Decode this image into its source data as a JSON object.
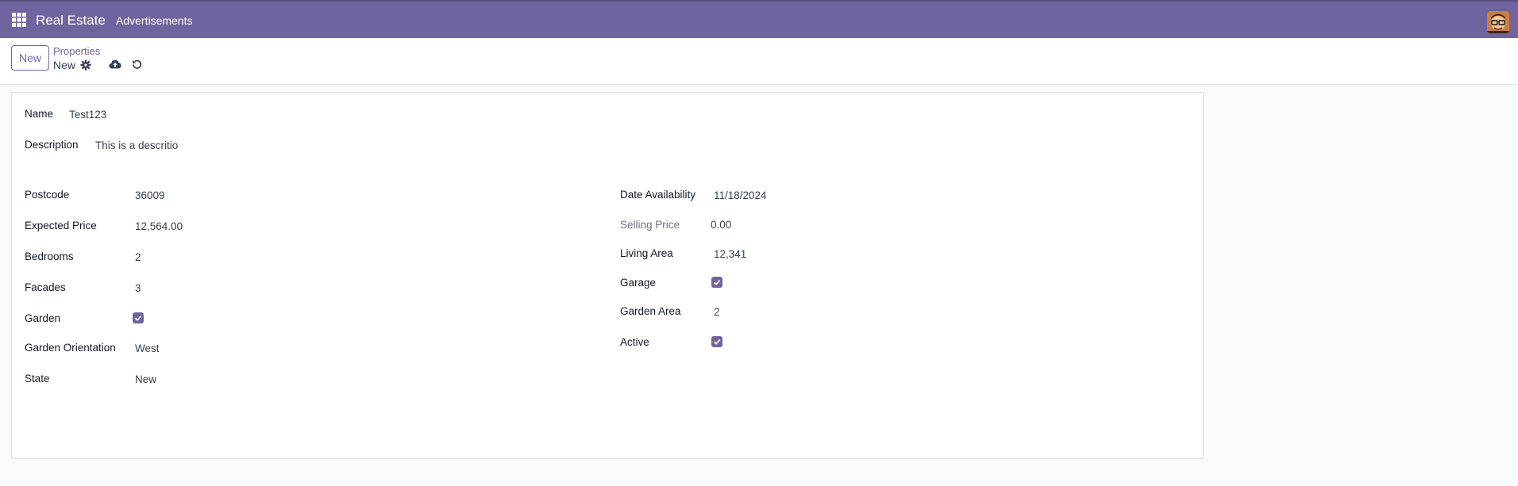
{
  "topbar": {
    "app_name": "Real Estate",
    "menu": [
      "Advertisements"
    ],
    "icons": {
      "apps": "apps-grid-icon",
      "avatar": "user-avatar"
    },
    "colors": {
      "brand": "#71639e"
    }
  },
  "control": {
    "new_label": "New",
    "breadcrumb_parent": "Properties",
    "breadcrumb_current": "New",
    "icons": [
      "gear-icon",
      "cloud-upload-icon",
      "undo-icon"
    ]
  },
  "form": {
    "name_label": "Name",
    "name_value": "Test123",
    "description_label": "Description",
    "description_value": "This is a descritio",
    "left": {
      "postcode_label": "Postcode",
      "postcode_value": "36009",
      "expected_price_label": "Expected Price",
      "expected_price_value": "12,564.00",
      "bedrooms_label": "Bedrooms",
      "bedrooms_value": "2",
      "facades_label": "Facades",
      "facades_value": "3",
      "garden_label": "Garden",
      "garden_checked": true,
      "garden_orientation_label": "Garden Orientation",
      "garden_orientation_value": "West",
      "state_label": "State",
      "state_value": "New"
    },
    "right": {
      "date_availability_label": "Date Availability",
      "date_availability_value": "11/18/2024",
      "selling_price_label": "Selling Price",
      "selling_price_value": "0.00",
      "living_area_label": "Living Area",
      "living_area_value": "12,341",
      "garage_label": "Garage",
      "garage_checked": true,
      "garden_area_label": "Garden Area",
      "garden_area_value": "2",
      "active_label": "Active",
      "active_checked": true
    }
  }
}
